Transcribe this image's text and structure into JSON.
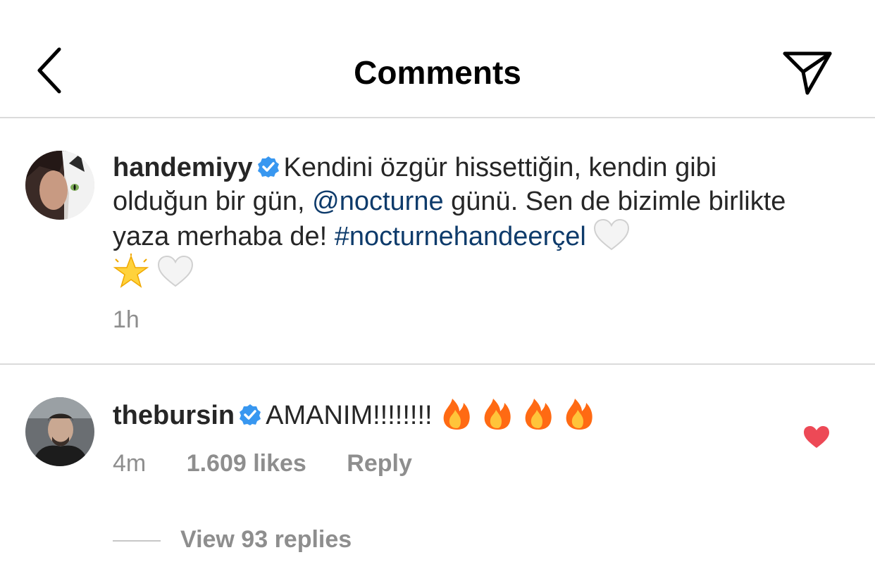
{
  "header": {
    "title": "Comments",
    "back_icon": "chevron-left-icon",
    "share_icon": "paper-plane-icon"
  },
  "caption": {
    "username": "handemiyy",
    "verified": true,
    "text_part1": "Kendini özgür hissettiğin, kendin gibi olduğun bir gün,",
    "mention": "@nocturne",
    "text_part2": "günü. Sen de bizimle birlikte yaza merhaba de!",
    "hashtag": "#nocturnehandeerçel",
    "emojis": [
      "white-heart",
      "glowing-star",
      "white-heart"
    ],
    "time": "1h"
  },
  "comment": {
    "username": "thebursin",
    "verified": true,
    "text": "AMANIM!!!!!!!!",
    "emojis": [
      "fire",
      "fire",
      "fire",
      "fire"
    ],
    "time": "4m",
    "likes": "1.609 likes",
    "reply_label": "Reply",
    "liked": true,
    "view_replies": "View 93 replies"
  },
  "colors": {
    "link": "#0e3b6b",
    "verified_badge": "#3897f0",
    "liked_heart": "#ed4956",
    "meta_gray": "#8e8e8e",
    "divider": "#dbdbdb"
  }
}
